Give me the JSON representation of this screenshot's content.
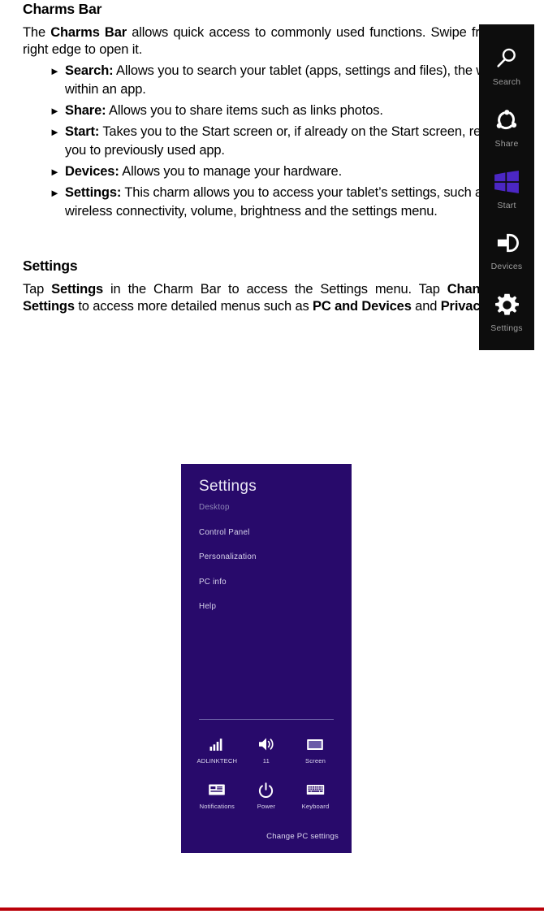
{
  "document": {
    "footer_rule_color": "#ba0009"
  },
  "charms_section": {
    "heading": "Charms Bar",
    "intro": {
      "pre": "The ",
      "bold": "Charms Bar",
      "post": " allows quick access to commonly used functions. Swipe from the right edge to open it."
    },
    "bullet_marker": "►",
    "items": [
      {
        "term": "Search:",
        "desc": " Allows you to search your tablet (apps, settings and files), the web, or within an app."
      },
      {
        "term": "Share:",
        "desc": " Allows you to share items such as links photos."
      },
      {
        "term": "Start:",
        "desc": " Takes you to the Start screen or, if already on the Start screen, returns you to previously used app."
      },
      {
        "term": "Devices:",
        "desc": " Allows you to manage your hardware."
      },
      {
        "term": "Settings:",
        "desc": " This charm allows you to access your tablet’s settings, such as wireless connectivity, volume, brightness and the settings menu."
      }
    ]
  },
  "charms_bar_figure": {
    "background_color": "#0d0d0d",
    "label_color": "#9d9d9d",
    "start_logo_color": "#4b27c4",
    "charms": [
      {
        "icon": "search-icon",
        "label": "Search"
      },
      {
        "icon": "share-icon",
        "label": "Share"
      },
      {
        "icon": "windows-start-icon",
        "label": "Start"
      },
      {
        "icon": "devices-icon",
        "label": "Devices"
      },
      {
        "icon": "settings-gear-icon",
        "label": "Settings"
      }
    ]
  },
  "settings_section": {
    "heading": "Settings",
    "paragraph": {
      "p1": "Tap ",
      "b1": "Settings",
      "p2": " in the Charm Bar to access the Settings menu. Tap ",
      "b2": "Change PC Settings",
      "p3": " to access more detailed menus such as ",
      "b3": "PC and Devices",
      "p4": " and ",
      "b4": "Privacy",
      "p5": "."
    }
  },
  "settings_panel_figure": {
    "background_color": "#280a6b",
    "title": "Settings",
    "links": [
      {
        "label": "Desktop",
        "dim": true
      },
      {
        "label": "Control Panel",
        "dim": false
      },
      {
        "label": "Personalization",
        "dim": false
      },
      {
        "label": "PC info",
        "dim": false
      },
      {
        "label": "Help",
        "dim": false
      }
    ],
    "tiles": [
      {
        "icon": "wifi-signal-icon",
        "label": "ADLINKTECH"
      },
      {
        "icon": "volume-icon",
        "label": "11"
      },
      {
        "icon": "screen-brightness-icon",
        "label": "Screen"
      },
      {
        "icon": "notifications-icon",
        "label": "Notifications"
      },
      {
        "icon": "power-icon",
        "label": "Power"
      },
      {
        "icon": "keyboard-icon",
        "label": "Keyboard"
      }
    ],
    "change_pc_settings": "Change PC settings"
  }
}
